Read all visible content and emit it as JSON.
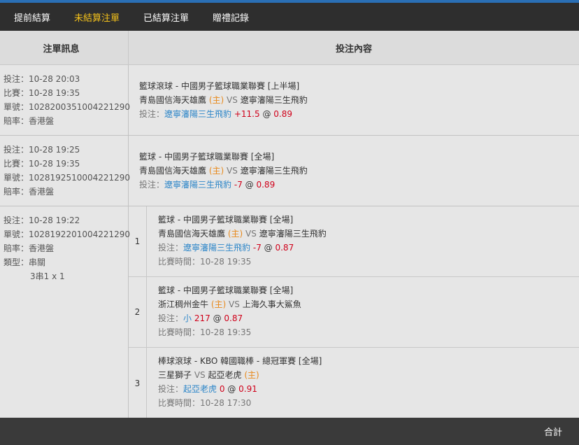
{
  "tabs": [
    {
      "label": "提前結算",
      "active": false
    },
    {
      "label": "未結算注單",
      "active": true
    },
    {
      "label": "已結算注單",
      "active": false
    },
    {
      "label": "贈禮記錄",
      "active": false
    }
  ],
  "table_header": {
    "col1": "注單訊息",
    "col2": "投注內容"
  },
  "bets": [
    {
      "info": [
        "投注：10-28 20:03",
        "比賽：10-28 19:35",
        "單號：1028200351004221290",
        "賠率：香港盤"
      ],
      "league": "籃球滾球 - 中國男子籃球職業聯賽 [上半場]",
      "home": "青島國信海天雄鷹",
      "home_tag": "(主)",
      "vs": "VS",
      "away": "遼寧瀋陽三生飛豹",
      "pick_label": "投注：",
      "pick": "遼寧瀋陽三生飛豹",
      "line": "+11.5",
      "at": "@",
      "odds": "0.89"
    },
    {
      "info": [
        "投注：10-28 19:25",
        "比賽：10-28 19:35",
        "單號：1028192510004221290",
        "賠率：香港盤"
      ],
      "league": "籃球 - 中國男子籃球職業聯賽 [全場]",
      "home": "青島國信海天雄鷹",
      "home_tag": "(主)",
      "vs": "VS",
      "away": "遼寧瀋陽三生飛豹",
      "pick_label": "投注：",
      "pick": "遼寧瀋陽三生飛豹",
      "line": "-7",
      "at": "@",
      "odds": "0.89"
    }
  ],
  "parlay": {
    "info": [
      "投注：10-28 19:22",
      "單號：1028192201004221290",
      "賠率：香港盤",
      "類型：串關"
    ],
    "type_detail": "3串1 x 1",
    "legs": [
      {
        "num": "1",
        "league": "籃球 - 中國男子籃球職業聯賽 [全場]",
        "team1": "青島國信海天雄鷹",
        "team1_tag": "(主)",
        "vs": "VS",
        "team2": "遼寧瀋陽三生飛豹",
        "team2_tag": "",
        "pick_label": "投注：",
        "pick": "遼寧瀋陽三生飛豹",
        "line": "-7",
        "at": "@",
        "odds": "0.87",
        "time": "比賽時間：10-28 19:35"
      },
      {
        "num": "2",
        "league": "籃球 - 中國男子籃球職業聯賽 [全場]",
        "team1": "浙江稠州金牛",
        "team1_tag": "(主)",
        "vs": "VS",
        "team2": "上海久事大鯊魚",
        "team2_tag": "",
        "pick_label": "投注：",
        "pick": "小",
        "line": "217",
        "at": "@",
        "odds": "0.87",
        "time": "比賽時間：10-28 19:35"
      },
      {
        "num": "3",
        "league": "棒球滾球 - KBO 韓國職棒 - 總冠軍賽 [全場]",
        "team1": "三星獅子",
        "team1_tag": "",
        "vs": "VS",
        "team2": "起亞老虎",
        "team2_tag": "(主)",
        "pick_label": "投注：",
        "pick": "起亞老虎",
        "line": "0",
        "at": "@",
        "odds": "0.91",
        "time": "比賽時間：10-28 17:30"
      }
    ]
  },
  "footer": {
    "total_label": "合計"
  },
  "colors": {
    "accent_tab": "#f5c21b",
    "pick_blue": "#2d86c8",
    "odds_red": "#d0021b",
    "home_orange": "#e8891b",
    "top_stripe": "#2a6fb5"
  }
}
